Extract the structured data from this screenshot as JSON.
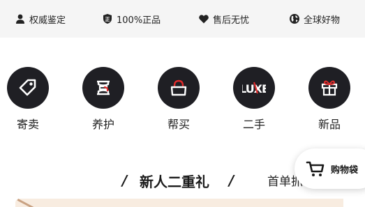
{
  "trust_bar": {
    "items": [
      {
        "label": "权威鉴定",
        "icon": "user-icon"
      },
      {
        "label": "100%正品",
        "icon": "genuine-badge-icon"
      },
      {
        "label": "售后无忧",
        "icon": "heart-icon"
      },
      {
        "label": "全球好物",
        "icon": "globe-icon"
      }
    ]
  },
  "services": [
    {
      "label": "寄卖",
      "icon": "tag-icon"
    },
    {
      "label": "养护",
      "icon": "care-icon"
    },
    {
      "label": "帮买",
      "icon": "bag-icon"
    },
    {
      "label": "二手",
      "icon": "luxe-logo-icon"
    },
    {
      "label": "新品",
      "icon": "gift-icon"
    }
  ],
  "promo": {
    "title": "新人二重礼",
    "slash": "/",
    "subtitle": "首单抓"
  },
  "cart": {
    "label": "购物袋"
  },
  "colors": {
    "trust_bar_bg": "#f5f5f5",
    "service_circle": "#1f1f24",
    "accent_red": "#e02a2a"
  }
}
